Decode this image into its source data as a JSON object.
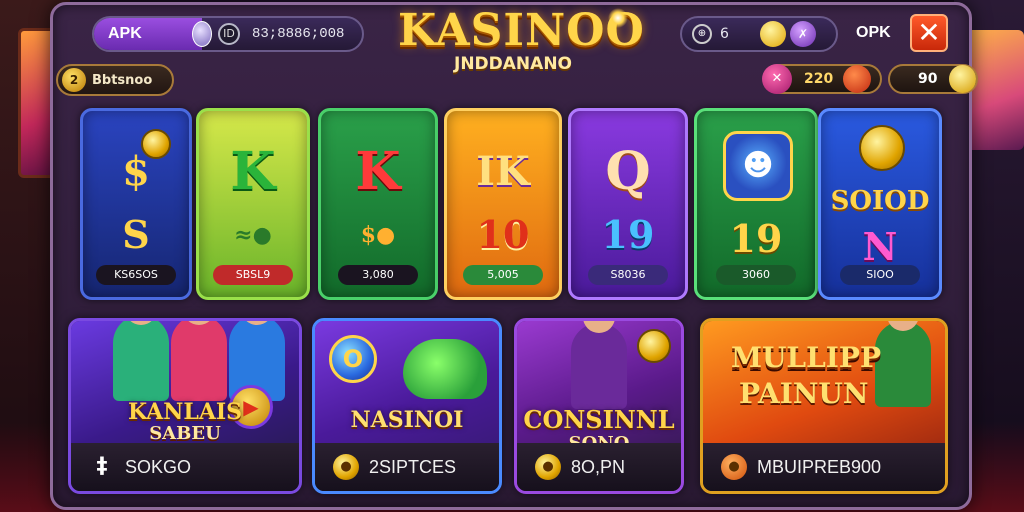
{
  "topbar": {
    "apk_label": "APK",
    "apk_coin_symbol": "ID",
    "apk_value": "83;8886;008",
    "logo_title": "KASINOO",
    "logo_subtitle": "JNDDANANO",
    "right_icon_symbol": "⊕",
    "right_value": "6",
    "right_gem_symbol": "✗",
    "opk_label": "OPK",
    "close_symbol": "✕"
  },
  "balance": {
    "icon_symbol": "2",
    "label": "Bbtsnoo"
  },
  "stats": {
    "stat1_icon_symbol": "✕",
    "stat1_value": "220",
    "stat2_value": "90"
  },
  "reels": [
    {
      "top": "$",
      "mid": "S",
      "label": "KS6SOS"
    },
    {
      "top": "K",
      "mid": "≈●",
      "label": "SBSL9"
    },
    {
      "top": "K",
      "mid": "$●",
      "label": "3,080"
    },
    {
      "top": "IK",
      "mid": "10",
      "label": "5,005"
    },
    {
      "top": "Q",
      "mid": "19",
      "label": "S8036"
    },
    {
      "top": "☻",
      "mid": "19",
      "label": "3060"
    },
    {
      "top": "SOIOD",
      "mid": "N",
      "label": "SIOO"
    }
  ],
  "cards": [
    {
      "title": "KANLAIS",
      "subtitle": "SABEU",
      "badge_symbol": "▶",
      "icon_symbol": "‡",
      "label": "SOKGO"
    },
    {
      "title": "NASINOI",
      "coin_symbol": "O",
      "icon_symbol": "●",
      "label": "2SIPTCES"
    },
    {
      "title": "CONSINNL",
      "subtitle": "SONO",
      "icon_symbol": "●",
      "label": "8O,PN"
    },
    {
      "title": "MULLIPP",
      "subtitle": "PAINUN",
      "icon_symbol": "●",
      "label": "MBUIPREB900"
    }
  ],
  "colors": {
    "frame_border": "#8e6b9b",
    "logo_gold": "#ffd54a",
    "close_red": "#e03a1a",
    "apk_purple": "#8a3ee0"
  },
  "icons": {
    "close": "close-icon",
    "coin": "coin-icon",
    "gem": "gem-icon",
    "balance": "balance-icon"
  }
}
